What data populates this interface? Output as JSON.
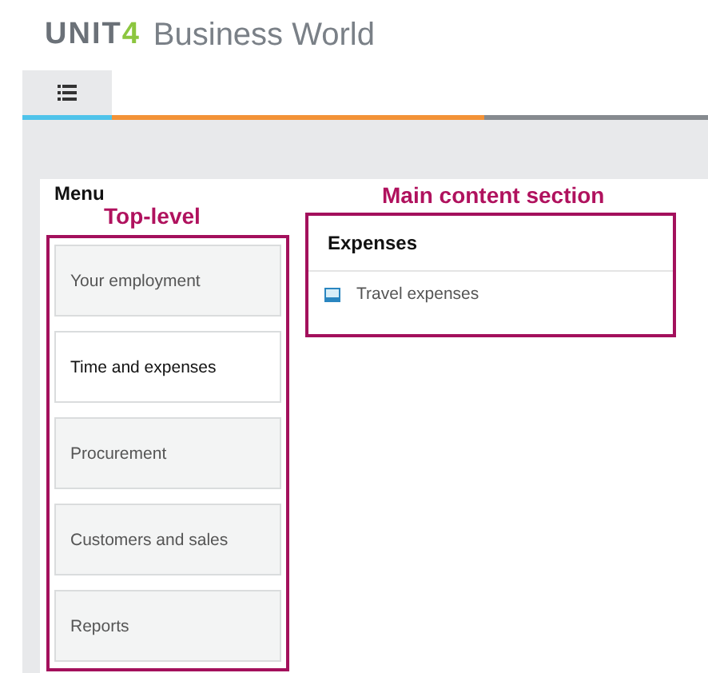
{
  "logo": {
    "brand": "UNIT",
    "accent": "4",
    "product": "Business World"
  },
  "tabs": [
    {
      "kind": "menu",
      "selected": true
    }
  ],
  "menu": {
    "title": "Menu",
    "annotation": "Top-level",
    "items": [
      {
        "label": "Your employment",
        "selected": false
      },
      {
        "label": "Time and expenses",
        "selected": true
      },
      {
        "label": "Procurement",
        "selected": false
      },
      {
        "label": "Customers and sales",
        "selected": false
      },
      {
        "label": "Reports",
        "selected": false
      }
    ]
  },
  "content": {
    "annotation": "Main content section",
    "heading": "Expenses",
    "links": [
      {
        "label": "Travel expenses"
      }
    ]
  }
}
